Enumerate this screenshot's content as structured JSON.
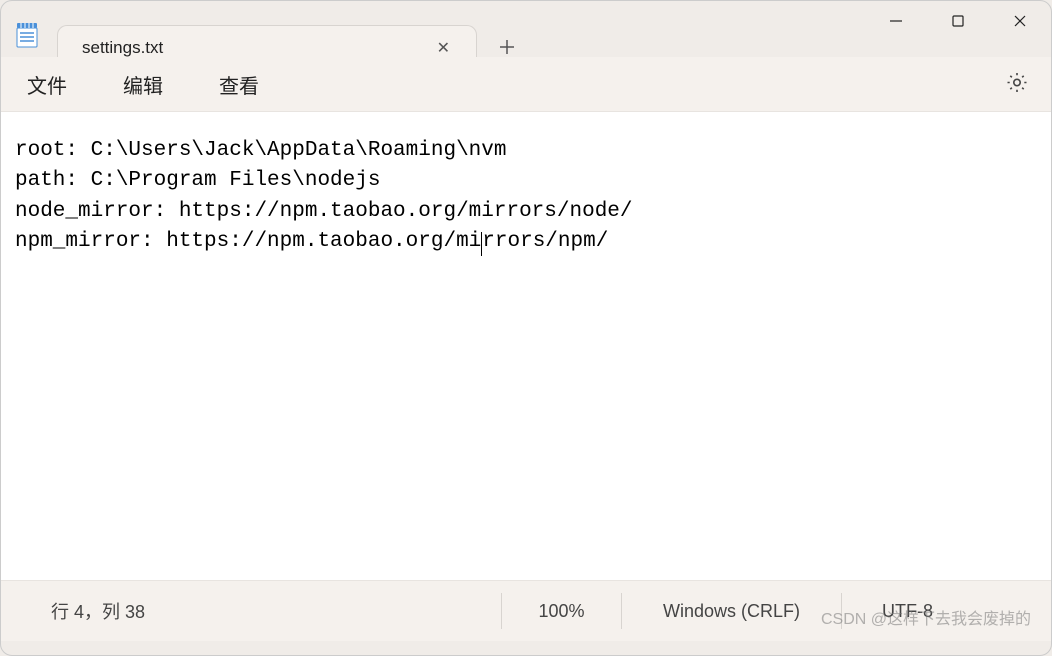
{
  "tab": {
    "title": "settings.txt"
  },
  "menu": {
    "file": "文件",
    "edit": "编辑",
    "view": "查看"
  },
  "editor": {
    "line1": "root: C:\\Users\\Jack\\AppData\\Roaming\\nvm",
    "line2": "path: C:\\Program Files\\nodejs",
    "line3": "node_mirror: https://npm.taobao.org/mirrors/node/",
    "line4a": "npm_mirror: https://npm.taobao.org/mi",
    "line4b": "rrors/npm/"
  },
  "status": {
    "position": "行 4，列 38",
    "zoom": "100%",
    "eol": "Windows (CRLF)",
    "encoding": "UTF-8"
  },
  "watermark": "CSDN @这样下去我会废掉的"
}
